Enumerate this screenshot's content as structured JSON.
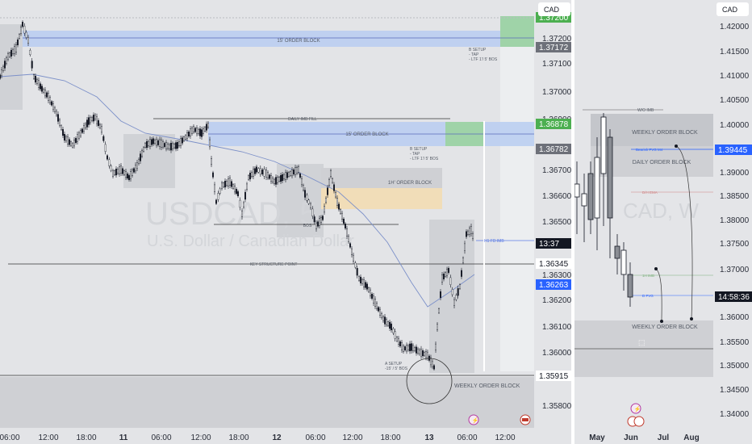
{
  "left_chart": {
    "currency_button": "CAD",
    "watermark_symbol": "USDCAD, 5",
    "watermark_desc": "U.S. Dollar / Canadian Dollar",
    "price_axis": [
      "1.37200",
      "1.37100",
      "1.37000",
      "1.36900",
      "1.36700",
      "1.36600",
      "1.36500",
      "1.36300",
      "1.36200",
      "1.36100",
      "1.36000",
      "1.35800"
    ],
    "price_tags": [
      {
        "text": "1.37200",
        "kind": "green"
      },
      {
        "text": "1.37172",
        "kind": "gray"
      },
      {
        "text": "1.36878",
        "kind": "green"
      },
      {
        "text": "1.36782",
        "kind": "gray"
      },
      {
        "text": "13:37",
        "kind": "black"
      },
      {
        "text": "1.36345",
        "kind": "white"
      },
      {
        "text": "1.36263",
        "kind": "blue"
      },
      {
        "text": "1.35915",
        "kind": "white"
      }
    ],
    "time_axis": [
      "06:00",
      "12:00",
      "18:00",
      "11",
      "06:00",
      "12:00",
      "18:00",
      "12",
      "06:00",
      "12:00",
      "18:00",
      "13",
      "06:00",
      "12:00"
    ],
    "annotations": {
      "order_block_top": "15' ORDER BLOCK",
      "daily_imb_fill": "DAILY IMB FILL",
      "order_block_mid": "15' ORDER BLOCK",
      "b_setup_top": "B SETUP\n- TAP\n- LTF 1'/ 5' BOS",
      "b_setup_mid": "B SETUP\n- TAP\n- LTF 1'/ 5' BOS",
      "order_block_1h": "1H' ORDER BLOCK",
      "bos": "BOS",
      "key_structure": "KEY STRUCTURE POINT",
      "a_setup": "A SETUP\n-15' / 5' BOS",
      "weekly_ob": "WEEKLY ORDER BLOCK",
      "h1_imb": "H1 FD IMB"
    }
  },
  "right_chart": {
    "currency_button": "CAD",
    "watermark": "CAD, W",
    "price_axis": [
      "1.42000",
      "1.41500",
      "1.41000",
      "1.40500",
      "1.40000",
      "1.39000",
      "1.38500",
      "1.38000",
      "1.37500",
      "1.37000",
      "1.36000",
      "1.35500",
      "1.35000",
      "1.34500",
      "1.34000"
    ],
    "price_tags": [
      {
        "text": "1.39445",
        "kind": "blue"
      },
      {
        "text": "14:58:36",
        "kind": "black"
      }
    ],
    "time_axis": [
      "May",
      "Jun",
      "Jul",
      "Aug"
    ],
    "annotations": {
      "wo_imb": "W/O IMB",
      "weekly_ob_top": "WEEKLY ORDER BLOCK",
      "daily_ob": "DAILY ORDER BLOCK",
      "weekly_ob_bottom": "WEEKLY ORDER BLOCK",
      "small_labels": [
        "Bearish FVG M4",
        "D/H EMA",
        "1H IMB",
        "D FVG"
      ]
    }
  },
  "colors": {
    "green_tag": "#4caf50",
    "blue_tag": "#2962ff",
    "gray_tag": "#6d7079",
    "black_tag": "#131722",
    "blue_zone": "#b3c8f0",
    "green_zone": "#a8d5b0",
    "orange_zone": "#f3ddba",
    "gray_zone": "#cdcfd4"
  }
}
